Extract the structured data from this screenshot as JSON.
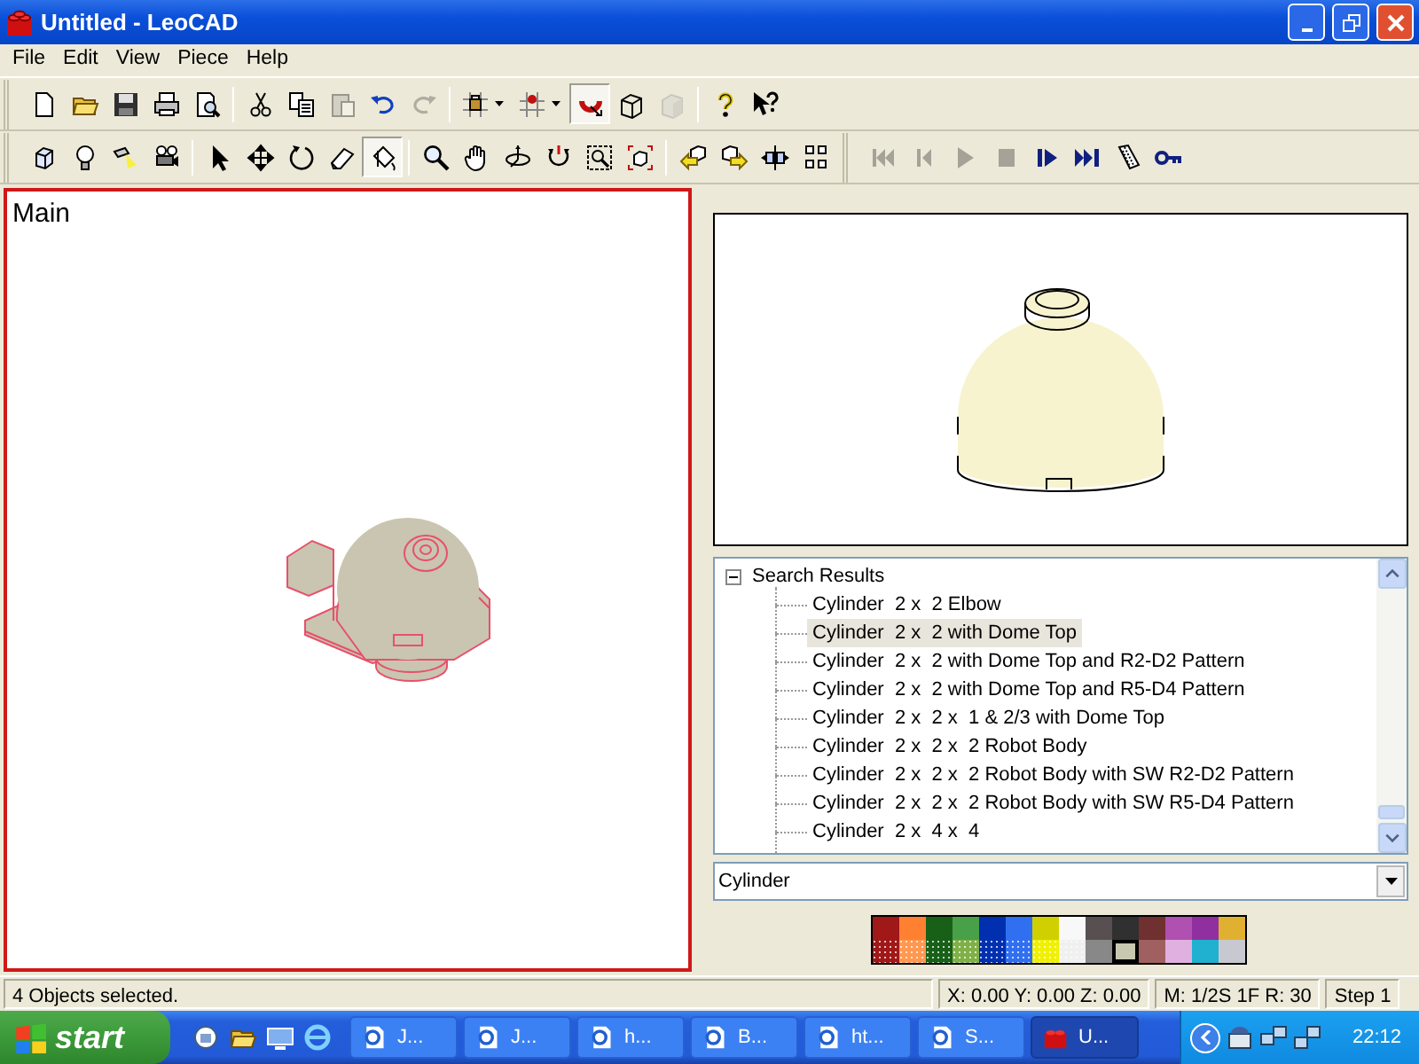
{
  "window": {
    "title": "Untitled - LeoCAD"
  },
  "menu": [
    "File",
    "Edit",
    "View",
    "Piece",
    "Help"
  ],
  "toolbars": [
    [
      {
        "kind": "button",
        "disabled": false,
        "pressed": false
      },
      {
        "kind": "button",
        "disabled": false,
        "pressed": false
      },
      {
        "kind": "button",
        "disabled": false,
        "pressed": false
      },
      {
        "kind": "button",
        "disabled": false,
        "pressed": false
      },
      {
        "kind": "button",
        "disabled": false,
        "pressed": false
      },
      {
        "kind": "separator"
      },
      {
        "kind": "button",
        "disabled": false,
        "pressed": false
      },
      {
        "kind": "button",
        "disabled": false,
        "pressed": false
      },
      {
        "kind": "button",
        "disabled": true,
        "pressed": false
      },
      {
        "kind": "button",
        "disabled": false,
        "pressed": false
      },
      {
        "kind": "button",
        "disabled": true,
        "pressed": false
      },
      {
        "kind": "separator"
      },
      {
        "kind": "dropdown",
        "disabled": false,
        "pressed": false
      },
      {
        "kind": "dropdown",
        "disabled": false,
        "pressed": false
      },
      {
        "kind": "button",
        "disabled": false,
        "pressed": true
      },
      {
        "kind": "button",
        "disabled": false,
        "pressed": false
      },
      {
        "kind": "button",
        "disabled": true,
        "pressed": false
      },
      {
        "kind": "separator"
      },
      {
        "kind": "button",
        "disabled": false,
        "pressed": false
      },
      {
        "kind": "button",
        "disabled": false,
        "pressed": false
      }
    ],
    [
      {
        "kind": "button",
        "disabled": false,
        "pressed": false
      },
      {
        "kind": "button",
        "disabled": false,
        "pressed": false
      },
      {
        "kind": "button",
        "disabled": false,
        "pressed": false
      },
      {
        "kind": "button",
        "disabled": false,
        "pressed": false
      },
      {
        "kind": "separator"
      },
      {
        "kind": "button",
        "disabled": false,
        "pressed": false
      },
      {
        "kind": "button",
        "disabled": false,
        "pressed": false
      },
      {
        "kind": "button",
        "disabled": false,
        "pressed": false
      },
      {
        "kind": "button",
        "disabled": false,
        "pressed": false
      },
      {
        "kind": "button",
        "disabled": false,
        "pressed": true
      },
      {
        "kind": "separator"
      },
      {
        "kind": "button",
        "disabled": false,
        "pressed": false
      },
      {
        "kind": "button",
        "disabled": false,
        "pressed": false
      },
      {
        "kind": "button",
        "disabled": false,
        "pressed": false
      },
      {
        "kind": "button",
        "disabled": false,
        "pressed": false
      },
      {
        "kind": "button",
        "disabled": false,
        "pressed": false
      },
      {
        "kind": "button",
        "disabled": false,
        "pressed": false
      },
      {
        "kind": "separator"
      },
      {
        "kind": "button",
        "disabled": false,
        "pressed": false
      },
      {
        "kind": "button",
        "disabled": false,
        "pressed": false
      },
      {
        "kind": "button",
        "disabled": false,
        "pressed": false
      },
      {
        "kind": "button",
        "disabled": false,
        "pressed": false
      }
    ],
    [
      {
        "kind": "button",
        "disabled": true,
        "pressed": false
      },
      {
        "kind": "button",
        "disabled": true,
        "pressed": false
      },
      {
        "kind": "button",
        "disabled": true,
        "pressed": false
      },
      {
        "kind": "button",
        "disabled": true,
        "pressed": false
      },
      {
        "kind": "button",
        "disabled": false,
        "pressed": false
      },
      {
        "kind": "button",
        "disabled": false,
        "pressed": false
      },
      {
        "kind": "button",
        "disabled": false,
        "pressed": false
      },
      {
        "kind": "button",
        "disabled": false,
        "pressed": false
      }
    ]
  ],
  "view": {
    "label": "Main",
    "active": true
  },
  "tree": {
    "label": "Search Results",
    "expanded": true,
    "children": [
      {
        "label": "Cylinder  2 x  2 Elbow",
        "selected": false
      },
      {
        "label": "Cylinder  2 x  2 with Dome Top",
        "selected": true
      },
      {
        "label": "Cylinder  2 x  2 with Dome Top and R2-D2 Pattern",
        "selected": false
      },
      {
        "label": "Cylinder  2 x  2 with Dome Top and R5-D4 Pattern",
        "selected": false
      },
      {
        "label": "Cylinder  2 x  2 x  1 & 2/3 with Dome Top",
        "selected": false
      },
      {
        "label": "Cylinder  2 x  2 x  2 Robot Body",
        "selected": false
      },
      {
        "label": "Cylinder  2 x  2 x  2 Robot Body with SW R2-D2 Pattern",
        "selected": false
      },
      {
        "label": "Cylinder  2 x  2 x  2 Robot Body with SW R5-D4 Pattern",
        "selected": false
      },
      {
        "label": "Cylinder  2 x  4 x  4",
        "selected": false
      }
    ]
  },
  "category": {
    "value": "Cylinder"
  },
  "palette": [
    {
      "color": "#a01818",
      "kind": "solid",
      "selected": false
    },
    {
      "color": "#ff8030",
      "kind": "solid",
      "selected": false
    },
    {
      "color": "#186018",
      "kind": "solid",
      "selected": false
    },
    {
      "color": "#48a048",
      "kind": "solid",
      "selected": false
    },
    {
      "color": "#0030b0",
      "kind": "solid",
      "selected": false
    },
    {
      "color": "#3070f0",
      "kind": "solid",
      "selected": false
    },
    {
      "color": "#d0d000",
      "kind": "solid",
      "selected": false
    },
    {
      "color": "#f8f8f8",
      "kind": "solid",
      "selected": false
    },
    {
      "color": "#585050",
      "kind": "solid",
      "selected": false
    },
    {
      "color": "#303030",
      "kind": "solid",
      "selected": false
    },
    {
      "color": "#703030",
      "kind": "solid",
      "selected": false
    },
    {
      "color": "#b050b0",
      "kind": "solid",
      "selected": false
    },
    {
      "color": "#9030a0",
      "kind": "solid",
      "selected": false
    },
    {
      "color": "#e0b030",
      "kind": "solid",
      "selected": false
    },
    {
      "color": "#a01818",
      "kind": "transparent",
      "selected": false
    },
    {
      "color": "#ff9850",
      "kind": "transparent",
      "selected": false
    },
    {
      "color": "#186018",
      "kind": "transparent",
      "selected": false
    },
    {
      "color": "#80b048",
      "kind": "transparent",
      "selected": false
    },
    {
      "color": "#0030b0",
      "kind": "transparent",
      "selected": false
    },
    {
      "color": "#3070f0",
      "kind": "transparent",
      "selected": false
    },
    {
      "color": "#f0f000",
      "kind": "transparent",
      "selected": false
    },
    {
      "color": "#f0f0f0",
      "kind": "transparent",
      "selected": false
    },
    {
      "color": "#888888",
      "kind": "solid",
      "selected": false
    },
    {
      "color": "#c8c8b0",
      "kind": "solid",
      "selected": true
    },
    {
      "color": "#a06060",
      "kind": "solid",
      "selected": false
    },
    {
      "color": "#e0b0e0",
      "kind": "solid",
      "selected": false
    },
    {
      "color": "#20b0d0",
      "kind": "solid",
      "selected": false
    },
    {
      "color": "#c8c8d0",
      "kind": "solid",
      "selected": false
    }
  ],
  "status_bar": [
    "4 Objects selected.",
    "X: 0.00 Y: 0.00 Z: 0.00",
    "M: 1/2S 1F R: 30",
    "Step 1"
  ],
  "taskbar": {
    "start": "start",
    "tasks": [
      {
        "label": "J...",
        "kind": "browser",
        "selected": false
      },
      {
        "label": "J...",
        "kind": "browser",
        "selected": false
      },
      {
        "label": "h...",
        "kind": "browser",
        "selected": false
      },
      {
        "label": "B...",
        "kind": "browser",
        "selected": false
      },
      {
        "label": "ht...",
        "kind": "browser",
        "selected": false
      },
      {
        "label": "S...",
        "kind": "browser",
        "selected": false
      },
      {
        "label": "U...",
        "kind": "brick",
        "selected": true
      }
    ],
    "clock": "22:12"
  }
}
